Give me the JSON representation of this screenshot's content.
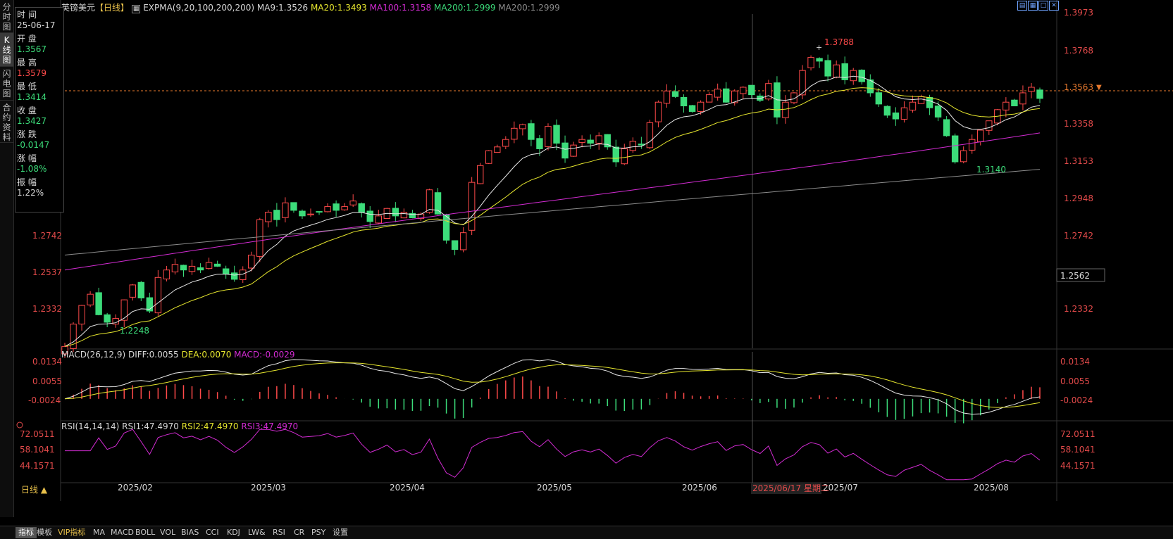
{
  "left_tabs": [
    "分时图",
    "K线图",
    "闪电图",
    "合约资料"
  ],
  "info": {
    "time_label": "时 间",
    "date": "25-06-17",
    "open_label": "开 盘",
    "open": "1.3567",
    "high_label": "最 高",
    "high": "1.3579",
    "low_label": "最 低",
    "low": "1.3414",
    "close_label": "收 盘",
    "close": "1.3427",
    "change_label": "涨 跌",
    "change": "-0.0147",
    "pct_label": "涨 幅",
    "pct": "-1.08%",
    "amp_label": "振 幅",
    "amp": "1.22%"
  },
  "main_legend": {
    "symbol": "英镑美元",
    "period": "【日线】",
    "indicator": "EXPMA(9,20,100,200,200)",
    "ma9": "MA9:1.3526",
    "ma20": "MA20:1.3493",
    "ma100": "MA100:1.3158",
    "ma200": "MA200:1.2999",
    "ma200b": "MA200:1.2999"
  },
  "macd_legend": {
    "name": "MACD(26,12,9)",
    "diff": "DIFF:0.0055",
    "dea": "DEA:0.0070",
    "macd": "MACD:-0.0029"
  },
  "rsi_legend": {
    "name": "RSI(14,14,14)",
    "rsi1": "RSI1:47.4970",
    "rsi2": "RSI2:47.4970",
    "rsi3": "RSI3:47.4970"
  },
  "annotations": {
    "high_mark": "1.3788",
    "low_mark_1": "1.2248",
    "low_mark_2": "1.3140"
  },
  "price_axis": {
    "ticks": [
      "1.3973",
      "1.3768",
      "1.3563",
      "1.3358",
      "1.3153",
      "1.2948",
      "1.2742",
      "1.2537",
      "1.2332"
    ],
    "current_price": "1.3563",
    "cursor_price": "1.2562"
  },
  "macd_axis": {
    "ticks": [
      "0.0134",
      "0.0055",
      "-0.0024"
    ]
  },
  "rsi_axis": {
    "ticks": [
      "72.0511",
      "58.1041",
      "44.1571"
    ]
  },
  "time_axis": {
    "period_button": "日线 ▲",
    "months": [
      "2025/02",
      "2025/03",
      "2025/04",
      "2025/05",
      "2025/06",
      "2025/07",
      "2025/08"
    ],
    "cursor_date": "2025/06/17 星期二"
  },
  "bottom_tabs": [
    "指标",
    "模板",
    "VIP指标",
    "MA",
    "MACD",
    "BOLL",
    "VOL",
    "BIAS",
    "CCI",
    "KDJ",
    "LW&",
    "RSI",
    "CR",
    "PSY",
    "设置"
  ],
  "toolbar_icons": [
    "layout-icon",
    "grid-icon",
    "fullscreen-icon",
    "close-icon"
  ],
  "colors": {
    "up": "#ff4a4a",
    "down": "#3cdc7a",
    "ma9": "#e8e8e8",
    "ma20": "#e6e62e",
    "ma100": "#d22bd2",
    "ma200": "#8c8c8c"
  },
  "chart_data": {
    "type": "candlestick",
    "ylim": [
      1.22,
      1.4
    ],
    "x": [
      "2025-01-13",
      "2025-08-22"
    ],
    "candles_note_removed": true,
    "closes_approx": [
      1.221,
      1.233,
      1.243,
      1.249,
      1.238,
      1.234,
      1.236,
      1.246,
      1.254,
      1.247,
      1.24,
      1.258,
      1.262,
      1.265,
      1.262,
      1.264,
      1.262,
      1.266,
      1.264,
      1.26,
      1.257,
      1.262,
      1.27,
      1.289,
      1.293,
      1.289,
      1.298,
      1.294,
      1.291,
      1.292,
      1.293,
      1.296,
      1.294,
      1.296,
      1.299,
      1.293,
      1.288,
      1.291,
      1.295,
      1.291,
      1.293,
      1.29,
      1.292,
      1.305,
      1.292,
      1.278,
      1.273,
      1.282,
      1.309,
      1.318,
      1.326,
      1.328,
      1.332,
      1.338,
      1.34,
      1.332,
      1.327,
      1.339,
      1.33,
      1.322,
      1.329,
      1.332,
      1.33,
      1.334,
      1.328,
      1.32,
      1.327,
      1.331,
      1.329,
      1.341,
      1.352,
      1.358,
      1.355,
      1.35,
      1.347,
      1.352,
      1.356,
      1.359,
      1.352,
      1.358,
      1.36,
      1.356,
      1.353,
      1.362,
      1.344,
      1.352,
      1.357,
      1.369,
      1.376,
      1.374,
      1.366,
      1.372,
      1.364,
      1.369,
      1.363,
      1.357,
      1.351,
      1.345,
      1.343,
      1.349,
      1.352,
      1.355,
      1.349,
      1.344,
      1.334,
      1.32,
      1.326,
      1.332,
      1.337,
      1.342,
      1.348,
      1.352,
      1.35,
      1.357,
      1.36,
      1.354
    ],
    "highs_marked": {
      "max": 1.3788,
      "min_left": 1.2248,
      "min_right": 1.314
    },
    "series": [
      {
        "name": "MA9"
      },
      {
        "name": "MA20"
      },
      {
        "name": "MA100"
      },
      {
        "name": "MA200"
      }
    ],
    "macd_ylim": [
      -0.006,
      0.016
    ],
    "rsi_ylim": [
      40,
      75
    ]
  }
}
